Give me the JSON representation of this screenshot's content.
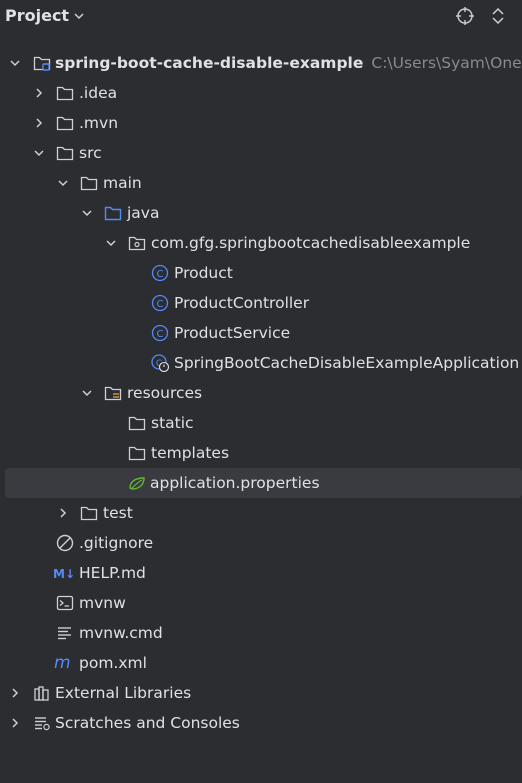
{
  "header": {
    "title": "Project"
  },
  "tree": {
    "root_label": "spring-boot-cache-disable-example",
    "root_path": "C:\\Users\\Syam\\One",
    "idea": ".idea",
    "mvn": ".mvn",
    "src": "src",
    "main": "main",
    "java": "java",
    "package": "com.gfg.springbootcachedisableexample",
    "class_product": "Product",
    "class_controller": "ProductController",
    "class_service": "ProductService",
    "class_app": "SpringBootCacheDisableExampleApplication",
    "resources": "resources",
    "static": "static",
    "templates": "templates",
    "app_props": "application.properties",
    "test": "test",
    "gitignore": ".gitignore",
    "help_md": "HELP.md",
    "mvnw": "mvnw",
    "mvnw_cmd": "mvnw.cmd",
    "pom": "pom.xml",
    "external_libraries": "External Libraries",
    "scratches": "Scratches and Consoles"
  },
  "icons": {
    "md_badge": "M↓",
    "class_letter": "C",
    "maven_letter": "m"
  },
  "colors": {
    "background": "#2b2d30",
    "text": "#dfe1e5",
    "muted": "#868a91",
    "selection": "#393b40",
    "folder_blue": "#548af7",
    "class_blue": "#548af7",
    "spring_green": "#5fb832"
  }
}
